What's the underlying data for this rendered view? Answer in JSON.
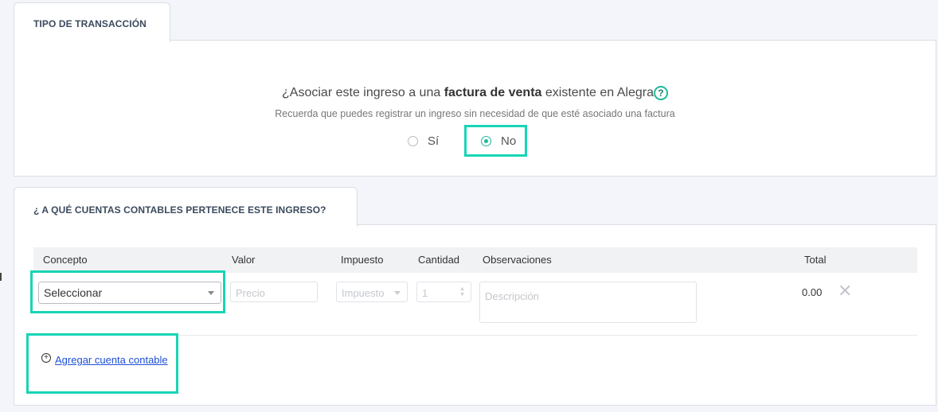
{
  "section1": {
    "tab_label": "TIPO DE TRANSACCIÓN",
    "question_prefix": "¿Asociar este ingreso a una ",
    "question_bold": "factura de venta",
    "question_suffix": " existente en Alegra",
    "hint": "Recuerda que puedes registrar un ingreso sin necesidad de que esté asociado una factura",
    "options": [
      {
        "label": "Sí",
        "selected": false
      },
      {
        "label": "No",
        "selected": true
      }
    ]
  },
  "section2": {
    "tab_label": "¿ A QUÉ CUENTAS CONTABLES PERTENECE ESTE INGRESO?",
    "columns": [
      "Concepto",
      "Valor",
      "Impuesto",
      "Cantidad",
      "Observaciones",
      "Total"
    ],
    "row": {
      "concepto": "Seleccionar",
      "valor_placeholder": "Precio",
      "impuesto": "Impuesto",
      "cantidad": "1",
      "observaciones_placeholder": "Descripción",
      "total": "0.00"
    },
    "add_link": "Agregar cuenta contable"
  },
  "icons": {
    "help": "question-circle-icon",
    "delete": "close-icon",
    "add": "plus-circle-icon"
  },
  "colors": {
    "accent": "#1eb89b",
    "highlight": "#17d5b4",
    "link": "#1f4fd6"
  }
}
